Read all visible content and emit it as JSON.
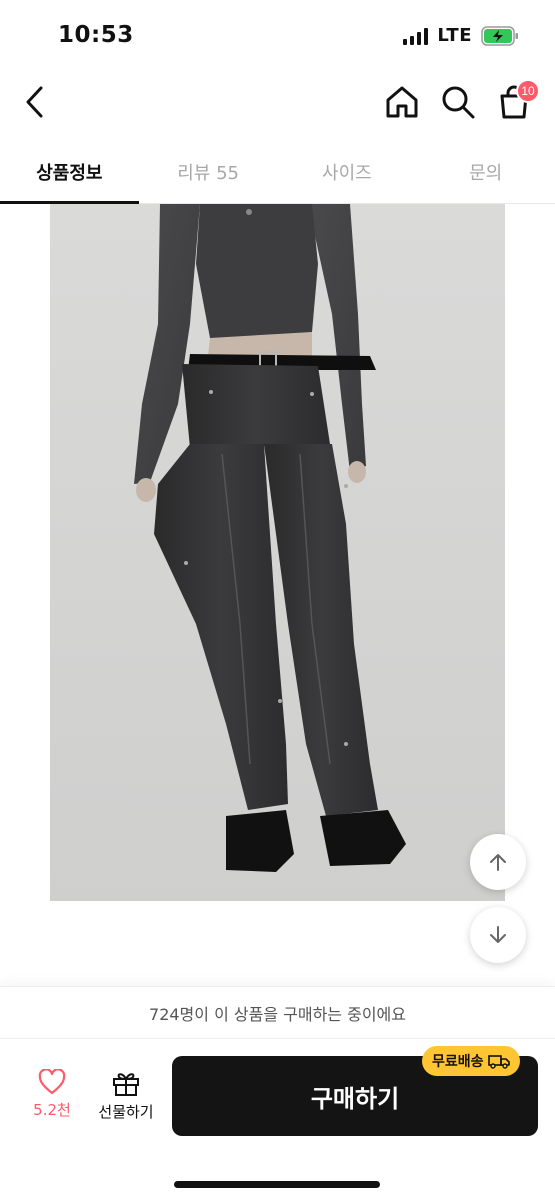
{
  "status_bar": {
    "time": "10:53",
    "network": "LTE",
    "battery_state": "charging",
    "icons": [
      "signal-icon",
      "battery-charging-icon"
    ]
  },
  "nav": {
    "icons": [
      "back-chevron-icon",
      "home-icon",
      "search-icon",
      "shopping-bag-icon"
    ],
    "cart_badge": "10"
  },
  "tabs": [
    {
      "label": "상품정보",
      "active": true
    },
    {
      "label": "리뷰 55",
      "active": false
    },
    {
      "label": "사이즈",
      "active": false
    },
    {
      "label": "문의",
      "active": false
    }
  ],
  "scroll_buttons": {
    "icons": [
      "arrow-up-icon",
      "arrow-down-icon"
    ]
  },
  "bottom_bar": {
    "buyers_text": "724명이 이 상품을 구매하는 중이에요",
    "like_count": "5.2천",
    "gift_label": "선물하기",
    "buy_label": "구매하기",
    "shipping_badge": "무료배송",
    "icons": [
      "heart-icon",
      "gift-icon",
      "truck-icon"
    ]
  },
  "colors": {
    "accent": "#ff5a6b",
    "buy_button": "#141414",
    "shipping_badge": "#ffc533",
    "battery_charging": "#33c759"
  }
}
